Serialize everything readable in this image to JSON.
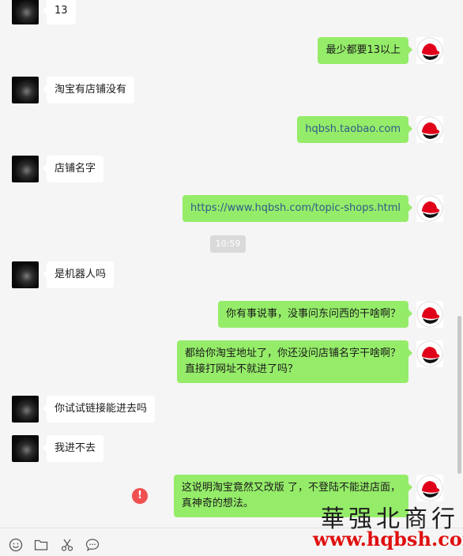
{
  "messages": [
    {
      "side": "left",
      "text": "13"
    },
    {
      "side": "right",
      "text": "最少都要13以上"
    },
    {
      "side": "left",
      "text": "淘宝有店铺没有"
    },
    {
      "side": "right",
      "text": "hqbsh.taobao.com"
    },
    {
      "side": "left",
      "text": "店铺名字"
    },
    {
      "side": "right",
      "text": "https://www.hqbsh.com/topic-shops.html"
    },
    {
      "side": "left",
      "text": "是机器人吗"
    },
    {
      "side": "right",
      "text": "你有事说事，没事问东问西的干啥啊？"
    },
    {
      "side": "right",
      "text": "都给你淘宝地址了，你还没问店铺名字干啥啊？\n直接打网址不就进了吗？"
    },
    {
      "side": "left",
      "text": "你试试链接能进去吗"
    },
    {
      "side": "left",
      "text": "我进不去"
    },
    {
      "side": "right",
      "text": "这说明淘宝竟然又改版 了，不登陆不能进店面，\n真神奇的想法。"
    }
  ],
  "timestamp": "10:59",
  "send_failed_mark": "!",
  "toolbar": {
    "icons": [
      "emoji-icon",
      "folder-icon",
      "scissors-icon",
      "chat-bubble-icon"
    ]
  },
  "watermark": {
    "chinese": "華强北商行",
    "url": "www.hqbsh.com"
  },
  "colors": {
    "background": "#f5f5f5",
    "bubble_self": "#95ec69",
    "bubble_other": "#ffffff",
    "link": "#2f5b8a",
    "error": "#f05050",
    "watermark_url": "#e01010"
  }
}
